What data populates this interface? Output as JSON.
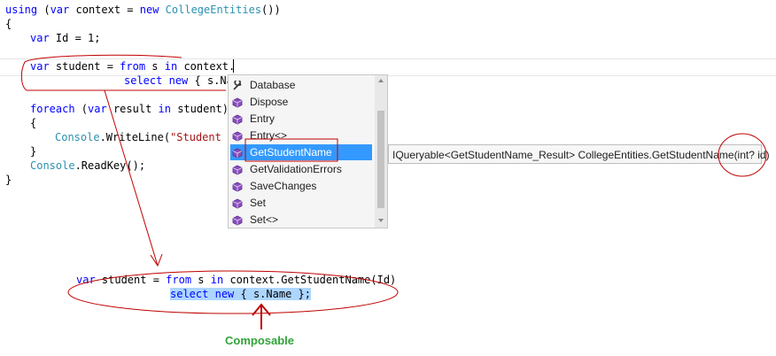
{
  "code": {
    "line1": {
      "k1": "using",
      "p1": " (",
      "k2": "var",
      "p2": " context = ",
      "k3": "new",
      "p3": " ",
      "t1": "CollegeEntities",
      "p4": "())"
    },
    "line2": "{",
    "line3": {
      "k1": "var",
      "p1": " Id = 1;"
    },
    "line5": {
      "k1": "var",
      "p1": " student = ",
      "k2": "from",
      "p2": " s ",
      "k3": "in",
      "p3": " context."
    },
    "line6": {
      "k1": "select",
      "p1": " ",
      "k2": "new",
      "p2": " { s.Na"
    },
    "line8": {
      "k1": "foreach",
      "p1": " (",
      "k2": "var",
      "p2": " result ",
      "k3": "in",
      "p3": " student)"
    },
    "line9": "{",
    "line10": {
      "t1": "Console",
      "p1": ".WriteLine(",
      "s1": "\"Student N"
    },
    "line11": "}",
    "line12": {
      "t1": "Console",
      "p1": ".ReadKey();"
    },
    "line13": "}"
  },
  "intellisense": {
    "items": [
      {
        "label": "Database",
        "icon": "wrench-icon"
      },
      {
        "label": "Dispose",
        "icon": "method-cube-icon"
      },
      {
        "label": "Entry",
        "icon": "method-cube-icon"
      },
      {
        "label": "Entry<>",
        "icon": "method-cube-icon"
      },
      {
        "label": "GetStudentName",
        "icon": "method-cube-icon",
        "selected": true
      },
      {
        "label": "GetValidationErrors",
        "icon": "method-cube-icon"
      },
      {
        "label": "SaveChanges",
        "icon": "method-cube-icon"
      },
      {
        "label": "Set",
        "icon": "method-cube-icon"
      },
      {
        "label": "Set<>",
        "icon": "method-cube-icon"
      }
    ]
  },
  "tooltip": {
    "signature": "IQueryable<GetStudentName_Result> CollegeEntities.GetStudentName",
    "param": "(int? id)"
  },
  "annotation": {
    "line1": {
      "k1": "var",
      "p1": " student = ",
      "k2": "from",
      "p2": " s ",
      "k3": "in",
      "p3": " context.GetStudentName(Id)"
    },
    "line2": {
      "k1": "select",
      "p1": " ",
      "k2": "new",
      "p2": " { s.Name };"
    },
    "label": "Composable"
  },
  "colors": {
    "keyword": "#0000ff",
    "type": "#2b91af",
    "string": "#a31515",
    "annotation_red": "#c00000",
    "composable_green": "#31a338",
    "selection": "#3399ff"
  }
}
